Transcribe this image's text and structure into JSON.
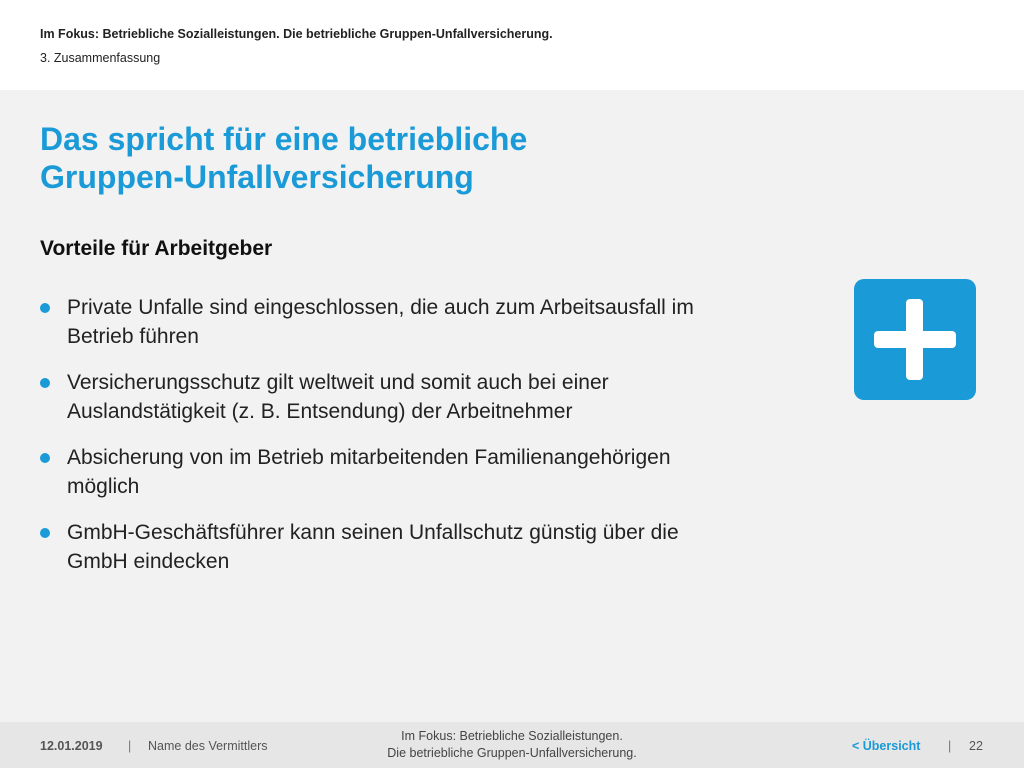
{
  "header": {
    "title": "Im Fokus: Betriebliche Sozialleistungen. Die betriebliche Gruppen-Unfallversicherung.",
    "section": "3. Zusammenfassung"
  },
  "main": {
    "title_line1": "Das spricht für eine betriebliche",
    "title_line2": "Gruppen-Unfallversicherung",
    "subtitle": "Vorteile für Arbeitgeber",
    "bullets": [
      {
        "line1": "Private Unfalle sind eingeschlossen, die auch zum Arbeitsausfall im",
        "line2": "Betrieb führen"
      },
      {
        "line1": "Versicherungsschutz gilt weltweit und somit auch bei einer",
        "line2": "Auslandstätigkeit (z. B. Entsendung) der Arbeitnehmer"
      },
      {
        "line1": "Absicherung von im Betrieb mitarbeitenden Familienangehörigen",
        "line2": "möglich"
      },
      {
        "line1": "GmbH-Geschäftsführer kann seinen Unfallschutz günstig über die",
        "line2": "GmbH eindecken"
      }
    ],
    "icon": "plus-icon",
    "accent_color": "#1a9ad6"
  },
  "footer": {
    "date": "12.01.2019",
    "separator": "|",
    "agent": "Name des Vermittlers",
    "center_line1": "Im Fokus: Betriebliche Sozialleistungen.",
    "center_line2": "Die betriebliche Gruppen-Unfallversicherung.",
    "overview_link": "< Übersicht",
    "page": "22"
  }
}
